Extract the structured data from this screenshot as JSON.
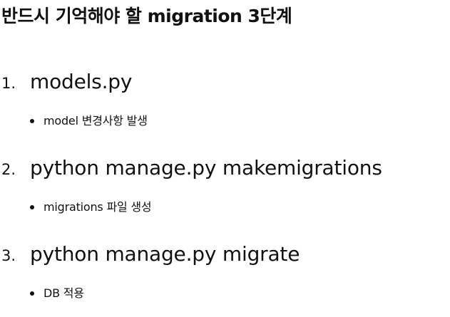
{
  "title": "반드시 기억해야 할 migration 3단계",
  "steps": [
    {
      "number": "1.",
      "label": "models.py",
      "bullet": "model 변경사항 발생"
    },
    {
      "number": "2.",
      "label": "python manage.py makemigrations",
      "bullet": "migrations 파일 생성"
    },
    {
      "number": "3.",
      "label": "python manage.py migrate",
      "bullet": "DB 적용"
    }
  ],
  "colors": {
    "text": "#111111",
    "background": "#ffffff"
  }
}
